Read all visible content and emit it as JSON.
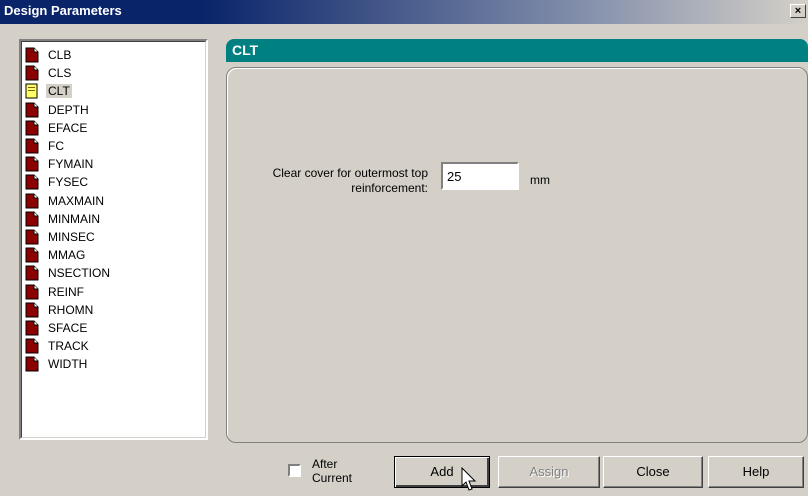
{
  "window": {
    "title": "Design Parameters",
    "close_label": "×"
  },
  "list": {
    "items": [
      {
        "label": "CLB",
        "icon": "red-document-icon",
        "selected": false
      },
      {
        "label": "CLS",
        "icon": "red-document-icon",
        "selected": false
      },
      {
        "label": "CLT",
        "icon": "yellow-document-icon",
        "selected": true
      },
      {
        "label": "DEPTH",
        "icon": "red-document-icon",
        "selected": false
      },
      {
        "label": "EFACE",
        "icon": "red-document-icon",
        "selected": false
      },
      {
        "label": "FC",
        "icon": "red-document-icon",
        "selected": false
      },
      {
        "label": "FYMAIN",
        "icon": "red-document-icon",
        "selected": false
      },
      {
        "label": "FYSEC",
        "icon": "red-document-icon",
        "selected": false
      },
      {
        "label": "MAXMAIN",
        "icon": "red-document-icon",
        "selected": false
      },
      {
        "label": "MINMAIN",
        "icon": "red-document-icon",
        "selected": false
      },
      {
        "label": "MINSEC",
        "icon": "red-document-icon",
        "selected": false
      },
      {
        "label": "MMAG",
        "icon": "red-document-icon",
        "selected": false
      },
      {
        "label": "NSECTION",
        "icon": "red-document-icon",
        "selected": false
      },
      {
        "label": "REINF",
        "icon": "red-document-icon",
        "selected": false
      },
      {
        "label": "RHOMN",
        "icon": "red-document-icon",
        "selected": false
      },
      {
        "label": "SFACE",
        "icon": "red-document-icon",
        "selected": false
      },
      {
        "label": "TRACK",
        "icon": "red-document-icon",
        "selected": false
      },
      {
        "label": "WIDTH",
        "icon": "red-document-icon",
        "selected": false
      }
    ]
  },
  "panel": {
    "header": "CLT",
    "header_color": "#008080",
    "param_label": "Clear cover for outermost top reinforcement:",
    "param_value": "25",
    "unit": "mm"
  },
  "footer": {
    "after_current_label": "After Current",
    "after_current_checked": false,
    "add_label": "Add",
    "assign_label": "Assign",
    "close_label": "Close",
    "help_label": "Help"
  },
  "colors": {
    "titlebar": "#0a246a",
    "face": "#d4d0c8",
    "icon_red": "#8b0000",
    "icon_yellow": "#ffff66"
  }
}
